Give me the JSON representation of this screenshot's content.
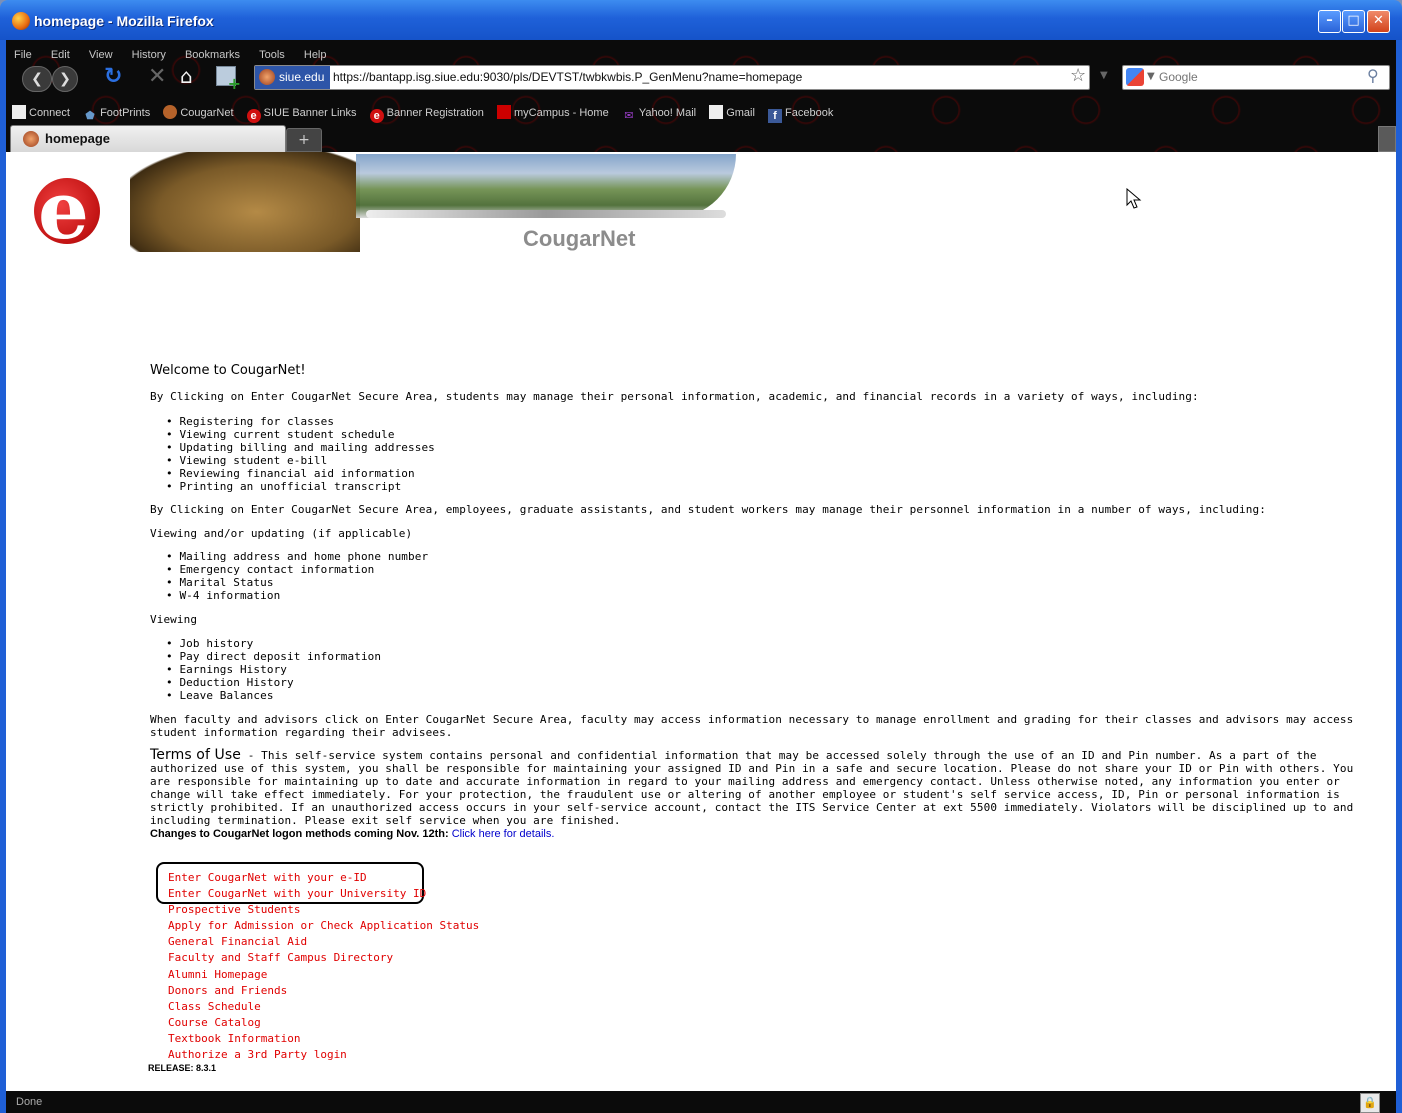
{
  "window": {
    "title": "homepage - Mozilla Firefox"
  },
  "menu": [
    "File",
    "Edit",
    "View",
    "History",
    "Bookmarks",
    "Tools",
    "Help"
  ],
  "urlbar": {
    "site": "siue.edu",
    "url": "https://bantapp.isg.siue.edu:9030/pls/DEVTST/twbkwbis.P_GenMenu?name=homepage"
  },
  "search": {
    "placeholder": "Google"
  },
  "bookmarks": [
    "Connect",
    "FootPrints",
    "CougarNet",
    "SIUE Banner Links",
    "Banner Registration",
    "myCampus - Home",
    "Yahoo! Mail",
    "Gmail",
    "Facebook"
  ],
  "tab": {
    "label": "homepage",
    "new_tab": "+"
  },
  "header": {
    "logo_letter": "e",
    "logo_text": "CougarNet"
  },
  "content": {
    "welcome": "Welcome to CougarNet!",
    "p1": "By Clicking on Enter CougarNet Secure Area, students may manage their personal information, academic, and financial records in a variety of ways, including:",
    "list1": [
      "Registering for classes",
      "Viewing current student schedule",
      "Updating billing and mailing addresses",
      "Viewing student e-bill",
      "Reviewing financial aid information",
      "Printing an unofficial transcript"
    ],
    "p2": "By Clicking on Enter CougarNet Secure Area, employees, graduate assistants, and student workers may manage their personnel information in a number of ways, including:",
    "p3": "Viewing and/or updating (if applicable)",
    "list2": [
      "Mailing address and home phone number",
      "Emergency contact information",
      "Marital Status",
      "W-4 information"
    ],
    "p4": "Viewing",
    "list3": [
      "Job history",
      "Pay direct deposit information",
      "Earnings History",
      "Deduction History",
      "Leave Balances"
    ],
    "p5": "When faculty and advisors click on Enter CougarNet Secure Area, faculty may access information necessary to manage enrollment and grading for their classes and advisors may access student information regarding their advisees.",
    "terms_head": "Terms of Use",
    "terms_body": " - This self-service system contains personal and confidential information that may be accessed solely through the use of an ID and Pin number. As a part of the authorized use of this system, you shall be responsible for maintaining your assigned ID and Pin in a safe and secure location. Please do not share your ID or Pin with others. You are responsible for maintaining up to date and accurate information in regard to your mailing address and emergency contact. Unless otherwise noted, any information you enter or change will take effect immediately. For your protection, the fraudulent use or altering of another employee or student's self service access, ID, Pin or personal information is strictly prohibited. If an unauthorized access occurs in your self-service account, contact the ITS Service Center at ext 5500 immediately. Violators will be disciplined up to and including termination. Please exit self service when you are finished.",
    "changes_label": "Changes to CougarNet logon methods coming Nov. 12th:",
    "changes_link": "Click here for details.",
    "links": [
      "Enter CougarNet with your e-ID",
      "Enter CougarNet with your University ID",
      "Prospective Students",
      "Apply for Admission or Check Application Status",
      "General Financial Aid",
      "Faculty and Staff Campus Directory",
      "Alumni Homepage",
      "Donors and Friends",
      "Class Schedule",
      "Course Catalog",
      "Textbook Information",
      "Authorize a 3rd Party login"
    ],
    "release": "RELEASE: 8.3.1"
  },
  "status": {
    "text": "Done"
  },
  "colors": {
    "link_red": "#e00000",
    "link_blue": "#0000cc",
    "titlebar_blue": "#1f61d9"
  }
}
